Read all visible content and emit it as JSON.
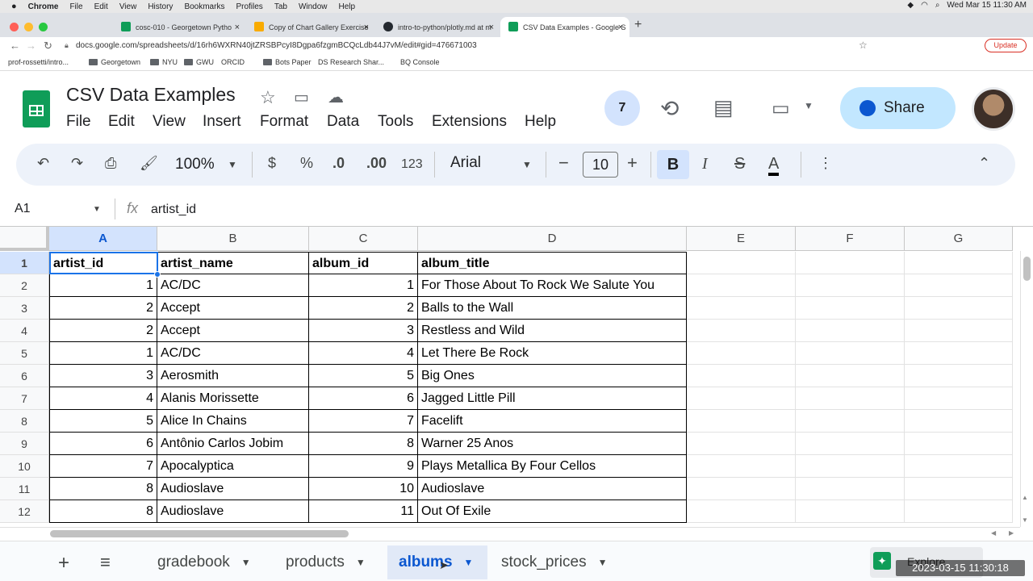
{
  "mac_menu": {
    "apple": "",
    "items": [
      "Chrome",
      "File",
      "Edit",
      "View",
      "History",
      "Bookmarks",
      "Profiles",
      "Tab",
      "Window",
      "Help"
    ],
    "clock": "Wed Mar 15  11:30 AM"
  },
  "browser": {
    "tabs": [
      {
        "title": "cosc-010 - Georgetown Pytho",
        "color": "#0f9d58"
      },
      {
        "title": "Copy of Chart Gallery Exercise",
        "color": "#f9ab00"
      },
      {
        "title": "intro-to-python/plotly.md at m",
        "color": "#24292f"
      },
      {
        "title": "CSV Data Examples - Google S",
        "color": "#0f9d58"
      }
    ],
    "close_glyph": "×",
    "new_tab_glyph": "+",
    "url": "docs.google.com/spreadsheets/d/16rh6WXRN40jtZRSBPcyI8Dgpa6fzgmBCQcLdb44J7vM/edit#gid=476671003",
    "update_label": "Update",
    "bookmarks": [
      "prof-rossetti/intro...",
      "Georgetown",
      "NYU",
      "GWU",
      "ORCID",
      "Bots Paper",
      "DS Research Shar...",
      "BQ Console"
    ]
  },
  "sheets": {
    "doc_title": "CSV Data Examples",
    "menu": [
      "File",
      "Edit",
      "View",
      "Insert",
      "Format",
      "Data",
      "Tools",
      "Extensions",
      "Help"
    ],
    "active_users_count": "7",
    "share_label": "Share",
    "toolbar": {
      "zoom": "100%",
      "currency": "$",
      "percent": "%",
      "decrease_decimals": ".0",
      "increase_decimals": ".00",
      "number_format": "123",
      "font": "Arial",
      "font_size": "10",
      "minus": "−",
      "plus": "+",
      "bold": "B",
      "italic": "I",
      "strike": "S",
      "text_color": "A"
    },
    "name_box": "A1",
    "fx": "fx",
    "formula": "artist_id",
    "columns": [
      "A",
      "B",
      "C",
      "D",
      "E",
      "F",
      "G"
    ],
    "rows": [
      "1",
      "2",
      "3",
      "4",
      "5",
      "6",
      "7",
      "8",
      "9",
      "10",
      "11",
      "12"
    ],
    "table": [
      [
        "artist_id",
        "artist_name",
        "album_id",
        "album_title"
      ],
      [
        "1",
        "AC/DC",
        "1",
        "For Those About To Rock We Salute You"
      ],
      [
        "2",
        "Accept",
        "2",
        "Balls to the Wall"
      ],
      [
        "2",
        "Accept",
        "3",
        "Restless and Wild"
      ],
      [
        "1",
        "AC/DC",
        "4",
        "Let There Be Rock"
      ],
      [
        "3",
        "Aerosmith",
        "5",
        "Big Ones"
      ],
      [
        "4",
        "Alanis Morissette",
        "6",
        "Jagged Little Pill"
      ],
      [
        "5",
        "Alice In Chains",
        "7",
        "Facelift"
      ],
      [
        "6",
        "Antônio Carlos Jobim",
        "8",
        "Warner 25 Anos"
      ],
      [
        "7",
        "Apocalyptica",
        "9",
        "Plays Metallica By Four Cellos"
      ],
      [
        "8",
        "Audioslave",
        "10",
        "Audioslave"
      ],
      [
        "8",
        "Audioslave",
        "11",
        "Out Of Exile"
      ]
    ],
    "sheet_tabs": [
      "gradebook",
      "products",
      "albums",
      "stock_prices"
    ],
    "active_sheet": "albums",
    "add_sheet": "+",
    "explore_label": "Explore"
  },
  "overlay_timestamp": "2023-03-15  11:30:18",
  "colors": {
    "accent": "#0b57d0",
    "share_bg": "#c2e7ff",
    "sheets_green": "#0f9d58"
  }
}
